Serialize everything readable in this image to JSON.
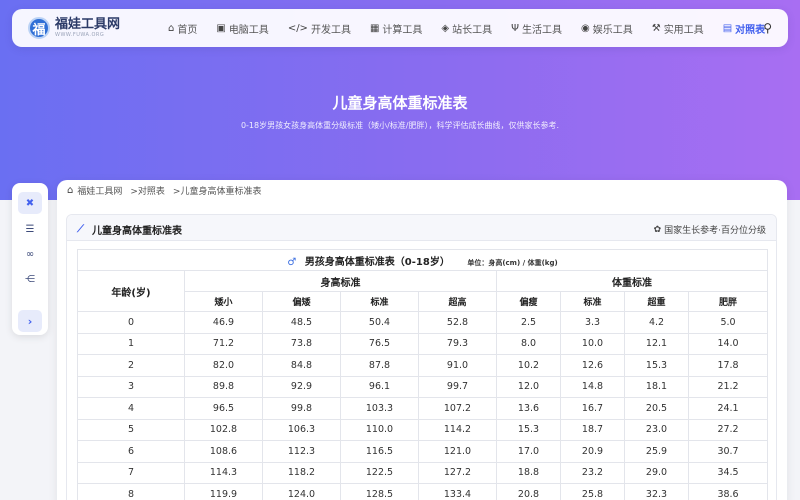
{
  "nav": {
    "logo_char": "福",
    "site_name": "福娃工具网",
    "site_domain": "WWW.FUWA.ORG",
    "items": [
      {
        "label": "首页",
        "icon": "home-icon",
        "glyph": "⌂"
      },
      {
        "label": "电脑工具",
        "icon": "desktop-icon",
        "glyph": "▣"
      },
      {
        "label": "开发工具",
        "icon": "code-icon",
        "glyph": "</>"
      },
      {
        "label": "计算工具",
        "icon": "calculator-icon",
        "glyph": "▦"
      },
      {
        "label": "站长工具",
        "icon": "briefcase-icon",
        "glyph": "◈"
      },
      {
        "label": "生活工具",
        "icon": "utensils-icon",
        "glyph": "Ψ"
      },
      {
        "label": "娱乐工具",
        "icon": "gamepad-icon",
        "glyph": "◉"
      },
      {
        "label": "实用工具",
        "icon": "wrench-icon",
        "glyph": "⚒"
      },
      {
        "label": "对照表",
        "icon": "table-icon",
        "glyph": "▤"
      }
    ]
  },
  "hero": {
    "title": "儿童身高体重标准表",
    "subtitle": "0-18岁男孩女孩身高体重分级标准（矮小/标准/肥胖），科学评估成长曲线，仅供家长参考."
  },
  "breadcrumb": {
    "home": "福娃工具网",
    "level1": ">对照表",
    "level2": ">儿童身高体重标准表"
  },
  "panel": {
    "title": "儿童身高体重标准表",
    "note": "国家生长参考·百分位分级"
  },
  "table": {
    "caption": "男孩身高体重标准表（0-18岁）",
    "unit": "单位：身高(cm) / 体重(kg)",
    "age_header": "年龄(岁)",
    "height_group": "身高标准",
    "weight_group": "体重标准",
    "height_cols": [
      "矮小",
      "偏矮",
      "标准",
      "超高"
    ],
    "weight_cols": [
      "偏瘦",
      "标准",
      "超重",
      "肥胖"
    ],
    "rows": [
      [
        "0",
        "46.9",
        "48.5",
        "50.4",
        "52.8",
        "2.5",
        "3.3",
        "4.2",
        "5.0"
      ],
      [
        "1",
        "71.2",
        "73.8",
        "76.5",
        "79.3",
        "8.0",
        "10.0",
        "12.1",
        "14.0"
      ],
      [
        "2",
        "82.0",
        "84.8",
        "87.8",
        "91.0",
        "10.2",
        "12.6",
        "15.3",
        "17.8"
      ],
      [
        "3",
        "89.8",
        "92.9",
        "96.1",
        "99.7",
        "12.0",
        "14.8",
        "18.1",
        "21.2"
      ],
      [
        "4",
        "96.5",
        "99.8",
        "103.3",
        "107.2",
        "13.6",
        "16.7",
        "20.5",
        "24.1"
      ],
      [
        "5",
        "102.8",
        "106.3",
        "110.0",
        "114.2",
        "15.3",
        "18.7",
        "23.0",
        "27.2"
      ],
      [
        "6",
        "108.6",
        "112.3",
        "116.5",
        "121.0",
        "17.0",
        "20.9",
        "25.9",
        "30.7"
      ],
      [
        "7",
        "114.3",
        "118.2",
        "122.5",
        "127.2",
        "18.8",
        "23.2",
        "29.0",
        "34.5"
      ],
      [
        "8",
        "119.9",
        "124.0",
        "128.5",
        "133.4",
        "20.8",
        "25.8",
        "32.3",
        "38.6"
      ]
    ]
  }
}
